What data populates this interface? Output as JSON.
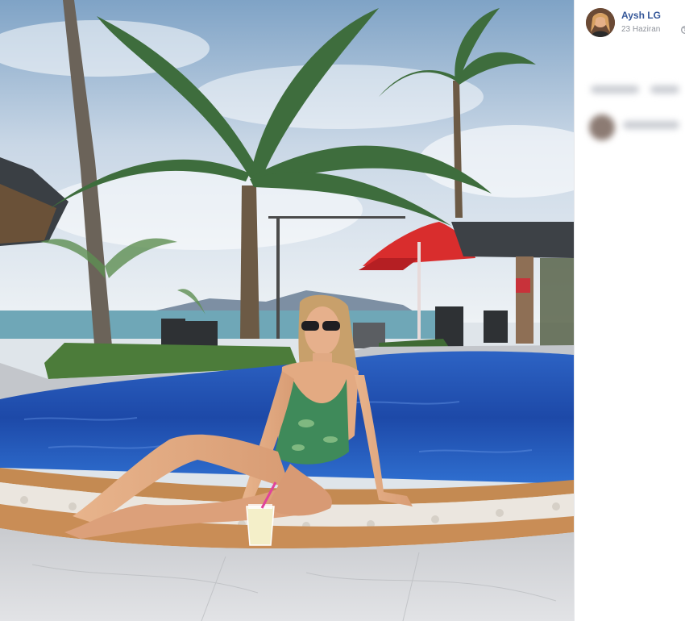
{
  "post": {
    "author": "Aysh LG",
    "date": "23 Haziran",
    "privacy_icon": "globe-icon"
  },
  "photo": {
    "description_icon": "pool-photo"
  },
  "colors": {
    "author_link": "#365899",
    "meta_text": "#90949c",
    "pool_water": "#1f4fb0",
    "umbrella": "#d92d2d"
  }
}
